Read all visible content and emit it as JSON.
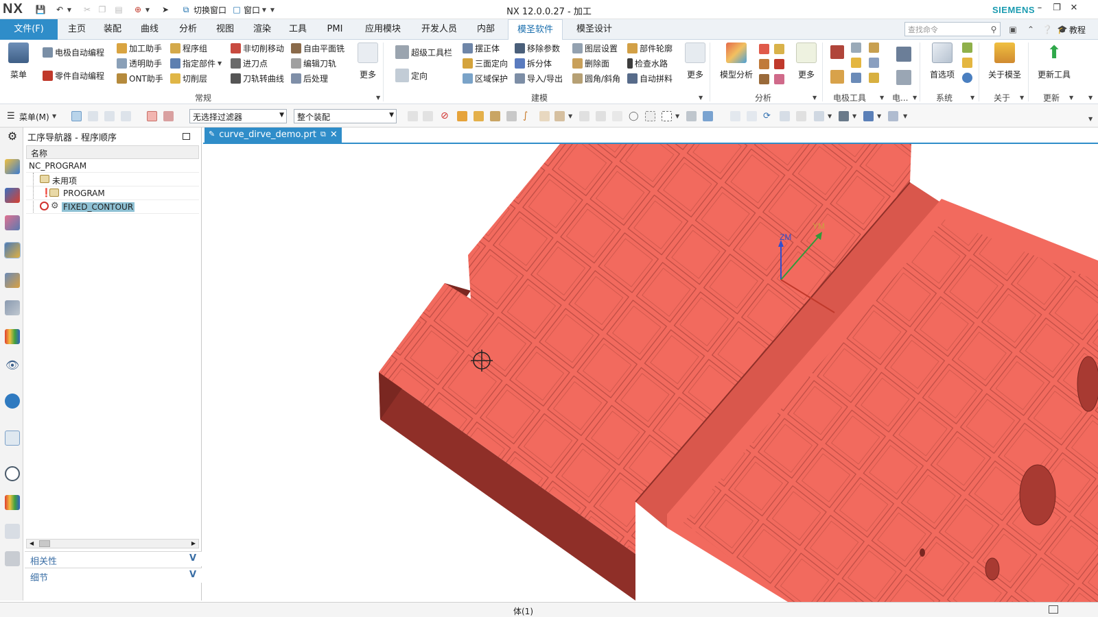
{
  "titlebar": {
    "logo": "NX",
    "switch_window": "切换窗口",
    "window": "窗口",
    "title": "NX 12.0.0.27 - 加工",
    "brand": "SIEMENS",
    "brand_color": "#1a9bb0"
  },
  "tabs": {
    "file": "文件(F)",
    "items": [
      "主页",
      "装配",
      "曲线",
      "分析",
      "视图",
      "渲染",
      "工具",
      "PMI",
      "应用模块",
      "开发人员",
      "内部",
      "模圣软件",
      "模圣设计"
    ],
    "active": "模圣软件",
    "search_placeholder": "查找命令",
    "tutorial": "教程",
    "accent": "#2f8dc9"
  },
  "ribbon": {
    "menu": "菜单",
    "general": {
      "electrode_auto": "电极自动编程",
      "part_auto": "零件自动编程",
      "machining_helper": "加工助手",
      "transparent_helper": "透明助手",
      "ont_helper": "ONT助手",
      "program_group": "程序组",
      "specify_part": "指定部件",
      "cut_layer": "切削层",
      "non_cut_move": "非切削移动",
      "entry_point": "进刀点",
      "path_to_curve": "刀轨转曲线",
      "free_plane_mill": "自由平面铣",
      "edit_path": "编辑刀轨",
      "post_process": "后处理",
      "more": "更多",
      "label": "常规"
    },
    "modeling": {
      "super_toolbar": "超级工具栏",
      "orient": "定向",
      "level_body": "摆正体",
      "three_view_orient": "三面定向",
      "region_protect": "区域保护",
      "remove_params": "移除参数",
      "split_body": "拆分体",
      "import_export": "导入/导出",
      "layer_settings": "图层设置",
      "delete_face": "删除面",
      "fillet_chamfer": "圆角/斜角",
      "part_outline": "部件轮廓",
      "check_waterway": "检查水路",
      "auto_patch": "自动拼料",
      "more": "更多",
      "label": "建模"
    },
    "analysis": {
      "model_analysis": "模型分析",
      "more": "更多",
      "label": "分析"
    },
    "electrode": {
      "label": "电极工具",
      "short": "电..."
    },
    "system": {
      "preferences": "首选项",
      "label": "系统"
    },
    "about": {
      "about_msheng": "关于模圣",
      "label": "关于"
    },
    "update": {
      "update_tool": "更新工具",
      "label": "更新"
    }
  },
  "toolbar2": {
    "menu": "菜单(M)",
    "filter": "无选择过滤器",
    "assembly_scope": "整个装配"
  },
  "navigator": {
    "title": "工序导航器 - 程序顺序",
    "column_name": "名称",
    "rows": [
      {
        "name": "NC_PROGRAM",
        "level": 0
      },
      {
        "name": "未用项",
        "level": 1
      },
      {
        "name": "PROGRAM",
        "level": 1
      },
      {
        "name": "FIXED_CONTOUR",
        "level": 1,
        "selected": true
      }
    ],
    "sections": [
      "相关性",
      "细节"
    ],
    "selection_color": "#8fc1d4"
  },
  "document": {
    "tab": "curve_dirve_demo.prt",
    "csys_z": "ZM",
    "csys_y": "YM",
    "model_color": "#f26a5e"
  },
  "status": {
    "text": "体(1)"
  }
}
